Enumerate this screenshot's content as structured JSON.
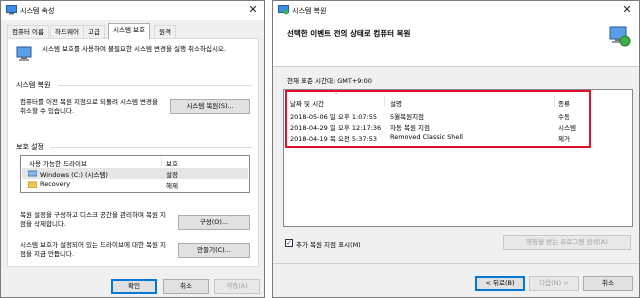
{
  "left_window": {
    "title": "시스템 속성",
    "tabs": [
      "컴퓨터 이름",
      "하드웨어",
      "고급",
      "시스템 보호",
      "원격"
    ],
    "intro_text": "시스템 보호를 사용하여 불필요한 시스템 변경을 실행 취소하십시오.",
    "restore_group": {
      "heading": "시스템 복원",
      "description": "컴퓨터를 이전 복원 지점으로 되돌려 시스템 변경을 취소할 수 있습니다.",
      "button": "시스템 복원(S)..."
    },
    "protection_group": {
      "heading": "보호 설정",
      "columns": [
        "사용 가능한 드라이브",
        "보호"
      ],
      "drives": [
        {
          "name": "Windows (C:) (시스템)",
          "status": "설정"
        },
        {
          "name": "Recovery",
          "status": "해제"
        }
      ],
      "configure_text": "복원 설정을 구성하고 디스크 공간을 관리하며 복원 지점을 삭제합니다.",
      "configure_button": "구성(O)...",
      "create_text": "시스템 보호가 설정되어 있는 드라이브에 대한 복원 지점을 지금 만듭니다.",
      "create_button": "만들기(C)..."
    },
    "buttons": {
      "ok": "확인",
      "cancel": "취소",
      "apply": "적용(A)"
    }
  },
  "right_window": {
    "title": "시스템 복원",
    "header": "선택한 이벤트 전의 상태로 컴퓨터 복원",
    "timezone": "현재 표준 시간대: GMT+9:00",
    "columns": [
      "날짜 및 시간",
      "설명",
      "종류"
    ],
    "restore_points": [
      {
        "date": "2018-05-06 일 오후 1:07:55",
        "description": "5월복원지점",
        "type": "수동"
      },
      {
        "date": "2018-04-29 일 오후 12:17:36",
        "description": "자동 복원 지점",
        "type": "시스템"
      },
      {
        "date": "2018-04-19 목 오전 5:37:53",
        "description": "Removed Classic Shell",
        "type": "제거"
      }
    ],
    "show_more_label": "추가 복원 지점 표시(M)",
    "show_more_checked": true,
    "scan_button": "영향을 받는 프로그램 검색(A)",
    "back_button": "< 뒤로(B)",
    "next_button": "다음(N) >",
    "cancel_button": "취소"
  },
  "colors": {
    "highlight": "#e0102c",
    "accent": "#0078d7"
  }
}
